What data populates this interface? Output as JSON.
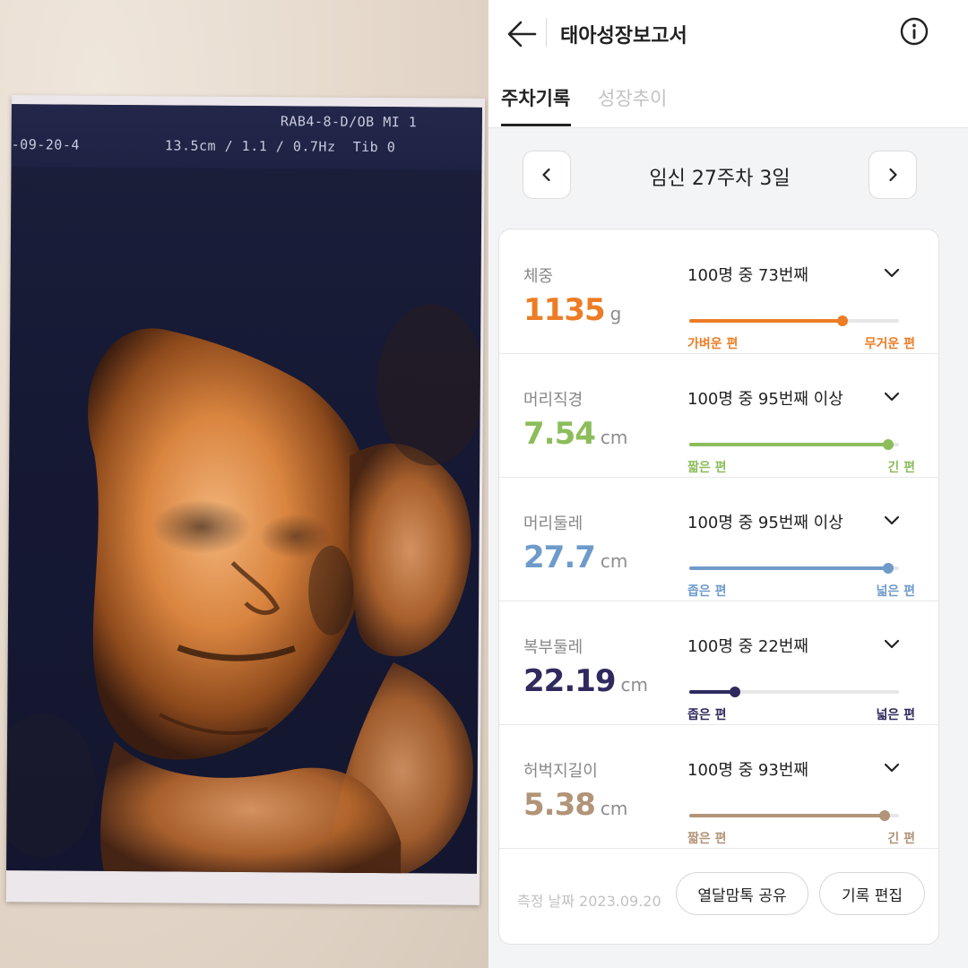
{
  "photo": {
    "header_line1": "RAB4-8-D/OB    MI 1",
    "header_line2_left": "-09-20-4",
    "header_line2_mid": "13.5cm / 1.1 / 0.7Hz",
    "header_line2_right": "Tib 0"
  },
  "app": {
    "title": "태아성장보고서",
    "tabs": [
      {
        "label": "주차기록",
        "active": true
      },
      {
        "label": "성장추이",
        "active": false
      }
    ],
    "week_label": "임신 27주차 3일",
    "metrics": [
      {
        "name": "체중",
        "value": "1135",
        "unit": "g",
        "rank": "100명 중 73번째",
        "percentile": 0.73,
        "low_label": "가벼운 편",
        "high_label": "무거운 편",
        "color": "#ec7d26"
      },
      {
        "name": "머리직경",
        "value": "7.54",
        "unit": "cm",
        "rank": "100명 중 95번째 이상",
        "percentile": 0.95,
        "low_label": "짧은 편",
        "high_label": "긴 편",
        "color": "#8cbd5a"
      },
      {
        "name": "머리둘레",
        "value": "27.7",
        "unit": "cm",
        "rank": "100명 중 95번째 이상",
        "percentile": 0.95,
        "low_label": "좁은 편",
        "high_label": "넓은 편",
        "color": "#6f9bcb"
      },
      {
        "name": "복부둘레",
        "value": "22.19",
        "unit": "cm",
        "rank": "100명 중 22번째",
        "percentile": 0.22,
        "low_label": "좁은 편",
        "high_label": "넓은 편",
        "color": "#2f2a5e"
      },
      {
        "name": "허벅지길이",
        "value": "5.38",
        "unit": "cm",
        "rank": "100명 중 93번째",
        "percentile": 0.93,
        "low_label": "짧은 편",
        "high_label": "긴 편",
        "color": "#b29478"
      }
    ],
    "footer": {
      "measure_date": "측정 날짜 2023.09.20",
      "share_label": "열달맘톡 공유",
      "edit_label": "기록 편집"
    },
    "icons": {
      "back": "arrow-left-icon",
      "info": "info-circle-icon",
      "prev": "chevron-left-icon",
      "next": "chevron-right-icon",
      "expand": "chevron-down-icon"
    }
  }
}
